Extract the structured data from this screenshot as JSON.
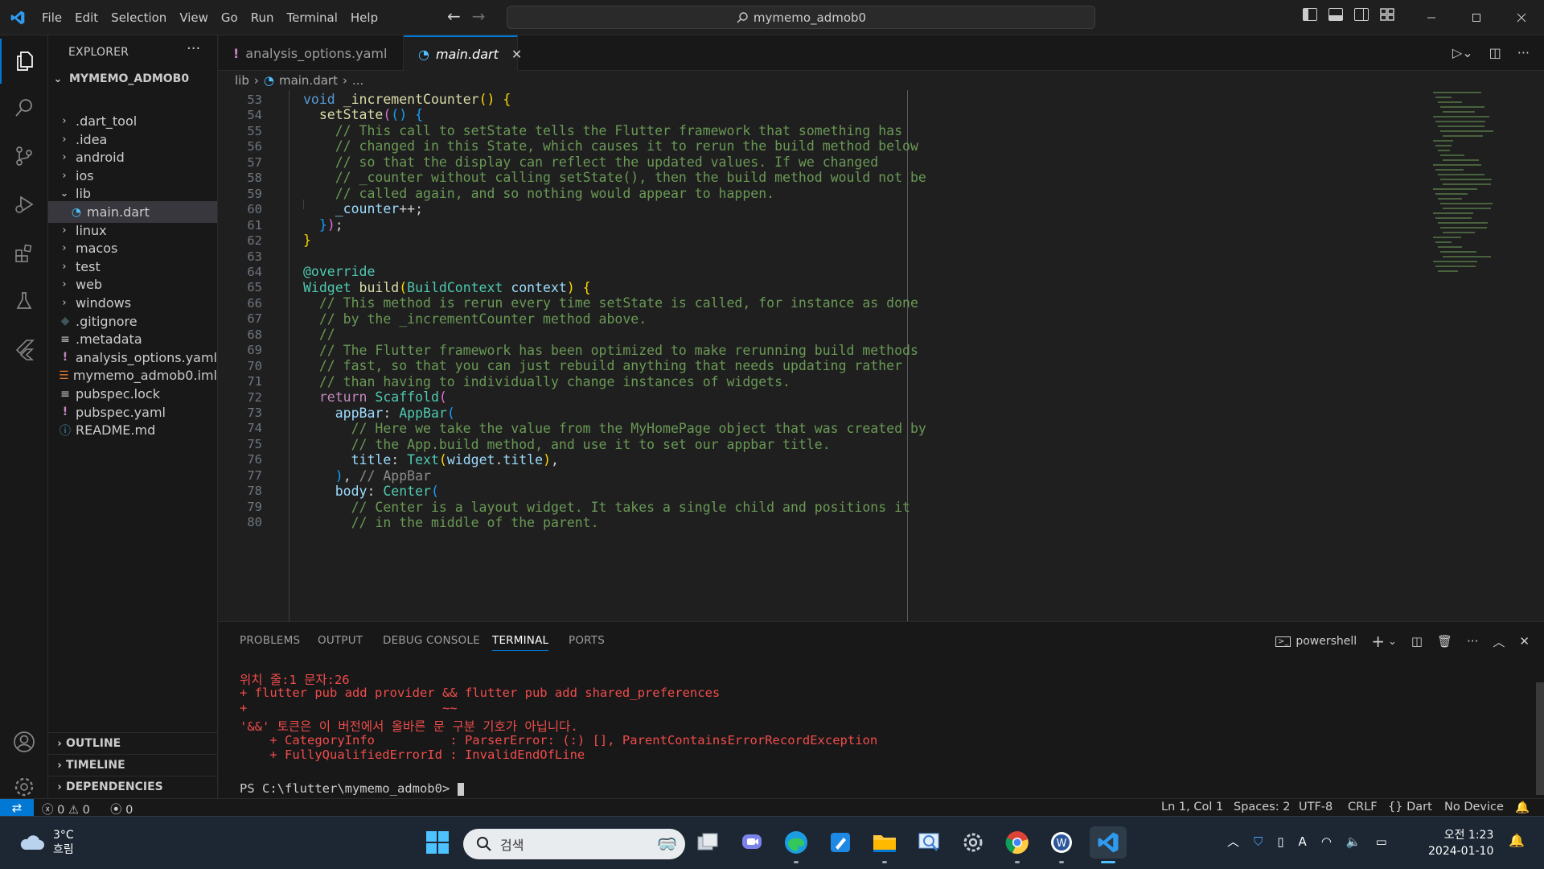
{
  "titlebar": {
    "menu": [
      "File",
      "Edit",
      "Selection",
      "View",
      "Go",
      "Run",
      "Terminal",
      "Help"
    ],
    "search_text": "mymemo_admob0"
  },
  "explorer": {
    "header": "EXPLORER",
    "folder": "MYMEMO_ADMOB0",
    "items": [
      {
        "label": ".dart_tool",
        "kind": "folder"
      },
      {
        "label": ".idea",
        "kind": "folder"
      },
      {
        "label": "android",
        "kind": "folder"
      },
      {
        "label": "ios",
        "kind": "folder"
      },
      {
        "label": "lib",
        "kind": "folder-open"
      },
      {
        "label": "main.dart",
        "kind": "dart-file"
      },
      {
        "label": "linux",
        "kind": "folder"
      },
      {
        "label": "macos",
        "kind": "folder"
      },
      {
        "label": "test",
        "kind": "folder"
      },
      {
        "label": "web",
        "kind": "folder"
      },
      {
        "label": "windows",
        "kind": "folder"
      },
      {
        "label": ".gitignore",
        "kind": "git-file"
      },
      {
        "label": ".metadata",
        "kind": "text-file"
      },
      {
        "label": "analysis_options.yaml",
        "kind": "yaml-file"
      },
      {
        "label": "mymemo_admob0.iml",
        "kind": "rss-file"
      },
      {
        "label": "pubspec.lock",
        "kind": "text-file"
      },
      {
        "label": "pubspec.yaml",
        "kind": "yaml-file"
      },
      {
        "label": "README.md",
        "kind": "info-file"
      }
    ],
    "sections": [
      "OUTLINE",
      "TIMELINE",
      "DEPENDENCIES"
    ]
  },
  "tabs": [
    {
      "label": "analysis_options.yaml",
      "active": false
    },
    {
      "label": "main.dart",
      "active": true
    }
  ],
  "breadcrumb": [
    "lib",
    "main.dart",
    "..."
  ],
  "editor": {
    "line_numbers": [
      "53",
      "54",
      "55",
      "56",
      "57",
      "58",
      "59",
      "60",
      "61",
      "62",
      "63",
      "64",
      "65",
      "66",
      "67",
      "68",
      "69",
      "70",
      "71",
      "72",
      "73",
      "74",
      "75",
      "76",
      "77",
      "78",
      "79",
      "80"
    ]
  },
  "panel": {
    "tabs": [
      "PROBLEMS",
      "OUTPUT",
      "DEBUG CONSOLE",
      "TERMINAL",
      "PORTS"
    ],
    "active_tab": "TERMINAL",
    "shell": "powershell",
    "terminal_lines": [
      "위치 줄:1 문자:26",
      "+ flutter pub add provider && flutter pub add shared_preferences",
      "+                          ~~",
      "'&&' 토큰은 이 버전에서 올바른 문 구분 기호가 아닙니다.",
      "    + CategoryInfo          : ParserError: (:) [], ParentContainsErrorRecordException",
      "    + FullyQualifiedErrorId : InvalidEndOfLine"
    ],
    "prompt": "PS C:\\flutter\\mymemo_admob0> "
  },
  "statusbar": {
    "errors": "0",
    "warnings": "0",
    "ports": "0",
    "position": "Ln 1, Col 1",
    "spaces": "Spaces: 2",
    "encoding": "UTF-8",
    "eol": "CRLF",
    "language": "Dart",
    "device": "No Device"
  },
  "taskbar": {
    "temperature": "3°C",
    "weather": "흐림",
    "search_placeholder": "검색",
    "time": "오전 1:23",
    "date": "2024-01-10"
  },
  "colors": {
    "accent": "#0078d4",
    "terminal_error": "#f14c4c",
    "comment": "#6a9955"
  }
}
